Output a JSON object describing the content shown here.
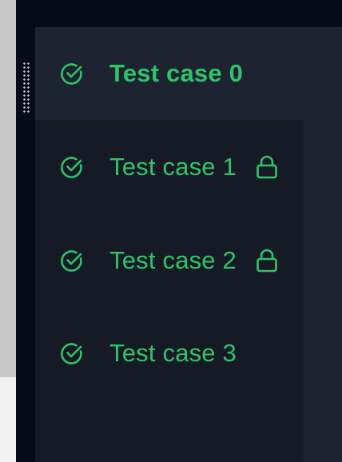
{
  "colors": {
    "accent_green": "#2ec46a",
    "list_bg": "#151a25",
    "active_bg": "#1d2331",
    "outer_bg": "#060b18"
  },
  "test_cases": [
    {
      "label": "Test case 0",
      "status_icon": "check-circle-icon",
      "locked": false,
      "active": true
    },
    {
      "label": "Test case 1",
      "status_icon": "check-circle-icon",
      "locked": true,
      "active": false
    },
    {
      "label": "Test case 2",
      "status_icon": "check-circle-icon",
      "locked": true,
      "active": false
    },
    {
      "label": "Test case 3",
      "status_icon": "check-circle-icon",
      "locked": false,
      "active": false
    }
  ]
}
